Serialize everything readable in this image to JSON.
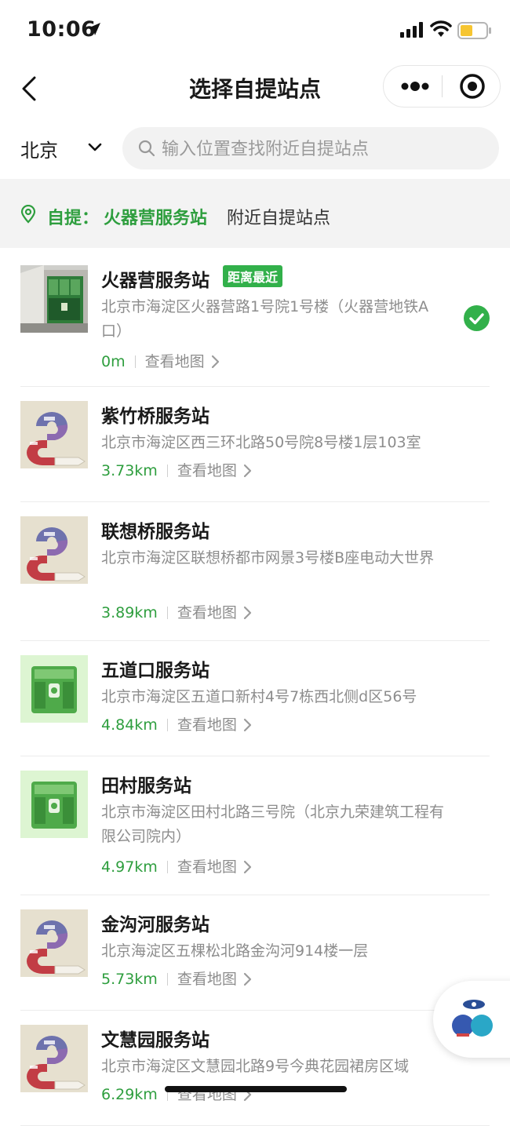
{
  "status_bar": {
    "time": "10:06"
  },
  "nav": {
    "title": "选择自提站点"
  },
  "search": {
    "city": "北京",
    "placeholder": "输入位置查找附近自提站点"
  },
  "current": {
    "label": "自提：",
    "station": "火器营服务站",
    "suffix": "附近自提站点"
  },
  "map_link": "查看地图",
  "stations": [
    {
      "name": "火器营服务站",
      "tag": "距离最近",
      "address": "北京市海淀区火器营路1号院1号楼（火器营地铁A口）",
      "distance": "0m",
      "selected": true,
      "thumb": "photo"
    },
    {
      "name": "紫竹桥服务站",
      "address": "北京市海淀区西三环北路50号院8号楼1层103室",
      "distance": "3.73km",
      "thumb": "infographic"
    },
    {
      "name": "联想桥服务站",
      "address": "北京市海淀区联想桥都市网景3号楼B座电动大世界",
      "distance": "3.89km",
      "thumb": "infographic"
    },
    {
      "name": "五道口服务站",
      "address": "北京市海淀区五道口新村4号7栋西北侧d区56号",
      "distance": "4.84km",
      "thumb": "green-store"
    },
    {
      "name": "田村服务站",
      "address": "北京市海淀区田村北路三号院（北京九荣建筑工程有限公司院内）",
      "distance": "4.97km",
      "thumb": "green-store"
    },
    {
      "name": "金沟河服务站",
      "address": "北京海淀区五棵松北路金沟河914楼一层",
      "distance": "5.73km",
      "thumb": "infographic"
    },
    {
      "name": "文慧园服务站",
      "address": "北京市海淀区文慧园北路9号今典花园裙房区域",
      "distance": "6.29km",
      "thumb": "infographic"
    }
  ],
  "colors": {
    "accent_green": "#2e9e3e",
    "tag_green": "#32b04a",
    "gray_text": "#8d8d8d"
  },
  "icons": [
    "location-arrow-icon",
    "signal-icon",
    "wifi-icon",
    "battery-icon",
    "back-icon",
    "more-icon",
    "target-icon",
    "chevron-down-icon",
    "search-icon",
    "location-pin-icon",
    "check-icon",
    "chevron-right-icon"
  ]
}
